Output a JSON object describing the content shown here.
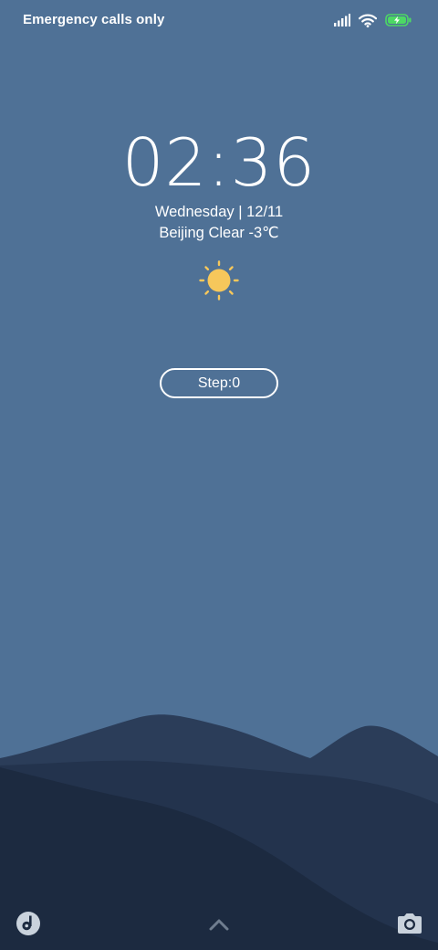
{
  "status_bar": {
    "carrier_text": "Emergency calls only",
    "icons": [
      "signal-icon",
      "wifi-icon",
      "battery-charging-icon"
    ],
    "battery_color": "#4cd964"
  },
  "lockscreen": {
    "time": "02:36",
    "date": "Wednesday | 12/11",
    "weather": "Beijing Clear -3℃",
    "weather_icon": "sun-icon",
    "sun_color": "#f6c75b",
    "step_label": "Step:0"
  },
  "bottom_bar": {
    "left_icon": "music-note-icon",
    "center_icon": "chevron-up-icon",
    "right_icon": "camera-icon"
  },
  "colors": {
    "background": "#4f7196",
    "mountain_back": "#2b3d59",
    "mountain_mid": "#23334d",
    "mountain_front": "#1c2a40"
  }
}
